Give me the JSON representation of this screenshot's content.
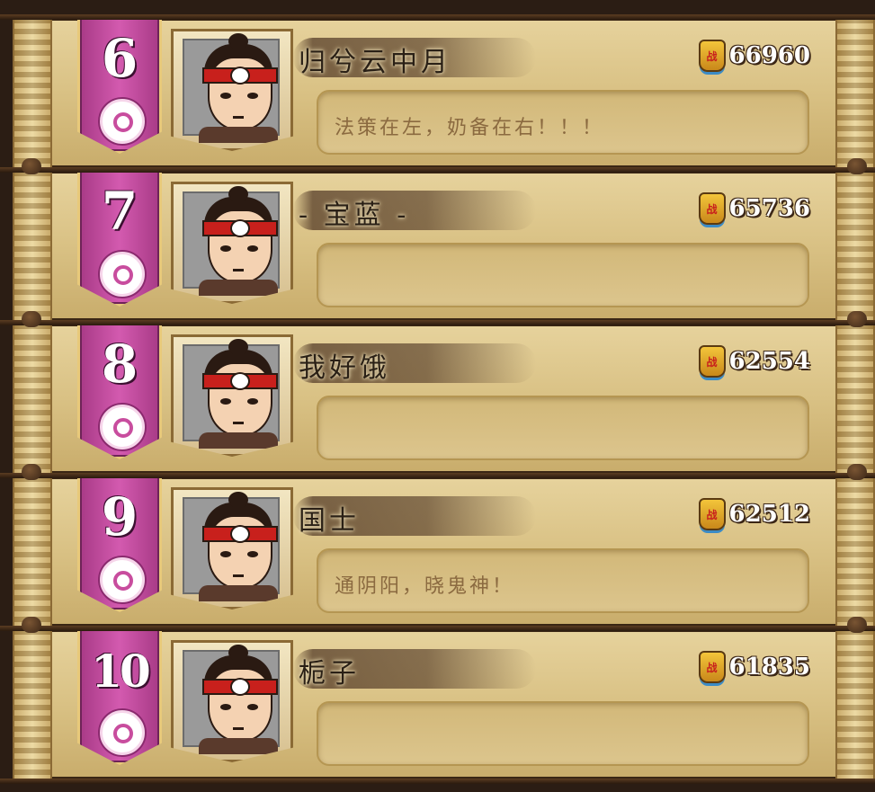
{
  "entries": [
    {
      "rank": "6",
      "name": "归兮云中月",
      "score": "66960",
      "signature": "法策在左，奶备在右！！！",
      "score_icon": "battle-badge-icon",
      "score_icon_char": "战"
    },
    {
      "rank": "7",
      "name": "- 宝蓝 -",
      "score": "65736",
      "signature": "",
      "score_icon": "battle-badge-icon",
      "score_icon_char": "战"
    },
    {
      "rank": "8",
      "name": "我好饿",
      "score": "62554",
      "signature": "",
      "score_icon": "battle-badge-icon",
      "score_icon_char": "战"
    },
    {
      "rank": "9",
      "name": "国士",
      "score": "62512",
      "signature": "通阴阳，晓鬼神！",
      "score_icon": "battle-badge-icon",
      "score_icon_char": "战"
    },
    {
      "rank": "10",
      "name": "栀子",
      "score": "61835",
      "signature": "",
      "score_icon": "battle-badge-icon",
      "score_icon_char": "战"
    }
  ],
  "colors": {
    "banner": "#d35aaf",
    "frame": "#d9c184",
    "headband": "#c8201c"
  }
}
